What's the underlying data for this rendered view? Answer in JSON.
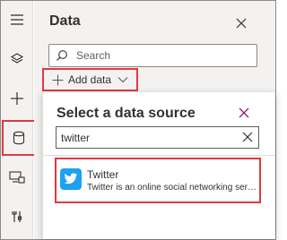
{
  "panel": {
    "title": "Data",
    "search_placeholder": "Search",
    "add_data_label": "Add data"
  },
  "rail": {
    "items": [
      "hamburger-menu-icon",
      "layers-icon",
      "plus-icon",
      "database-icon",
      "media-icon",
      "tools-icon"
    ],
    "selected": "database-icon"
  },
  "flyout": {
    "title": "Select a data source",
    "search_value": "twitter",
    "results": [
      {
        "name": "Twitter",
        "description": "Twitter is an online social networking service t..."
      }
    ]
  },
  "colors": {
    "highlight": "#e0393e",
    "twitter_blue": "#1da1f2",
    "rail_bg": "#f3f2f1",
    "panel_bg": "#f3f2f1"
  }
}
